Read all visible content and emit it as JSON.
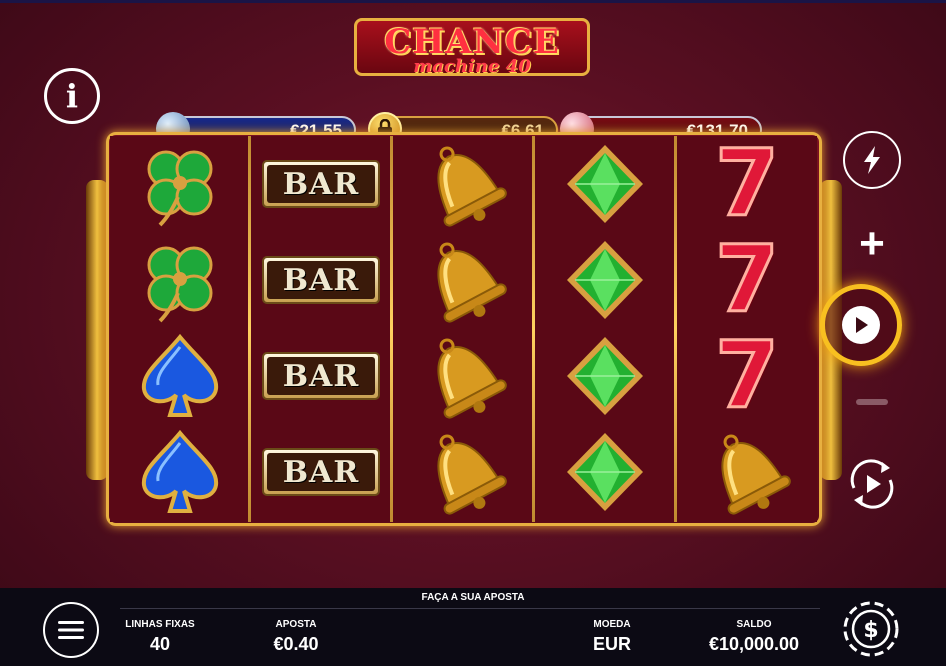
{
  "logo": {
    "title": "CHANCE",
    "subtitle": "machine 40"
  },
  "jackpots": [
    {
      "value": "€21.55",
      "color": "#1a2a8a"
    },
    {
      "value": "€6.61",
      "color": "#5a2a10"
    },
    {
      "value": "€131.70",
      "color": "#7a0c14"
    }
  ],
  "reels": [
    {
      "symbols": [
        "clover-icon",
        "clover-icon",
        "spade-icon",
        "spade-icon"
      ]
    },
    {
      "symbols": [
        "bar-symbol",
        "bar-symbol",
        "bar-symbol",
        "bar-symbol"
      ]
    },
    {
      "symbols": [
        "bell-icon",
        "bell-icon",
        "bell-icon",
        "bell-icon"
      ]
    },
    {
      "symbols": [
        "diamond-icon",
        "diamond-icon",
        "diamond-icon",
        "diamond-icon"
      ]
    },
    {
      "symbols": [
        "seven-symbol",
        "seven-symbol",
        "seven-symbol",
        "bell-icon"
      ]
    }
  ],
  "bar_text": "BAR",
  "seven_text": "7",
  "bottom": {
    "prompt": "FAÇA A SUA APOSTA",
    "lines_label": "LINHAS FIXAS",
    "lines_value": "40",
    "bet_label": "APOSTA",
    "bet_value": "€0.40",
    "currency_label": "MOEDA",
    "currency_value": "EUR",
    "balance_label": "SALDO",
    "balance_value": "€10,000.00"
  },
  "controls": {
    "plus": "+",
    "info": "i"
  },
  "colors": {
    "accent": "#f8c020",
    "background": "#5a0f22",
    "frame": "#e8b040"
  }
}
